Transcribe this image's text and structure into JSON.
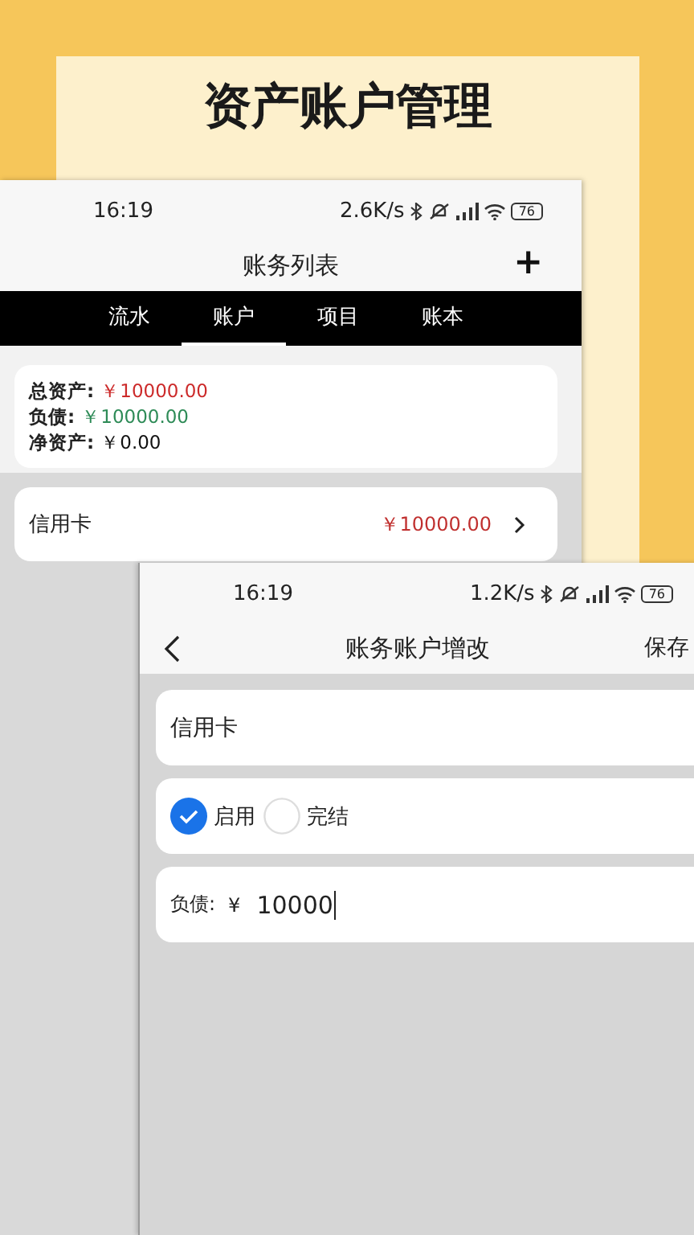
{
  "heading": "资产账户管理",
  "back_screen": {
    "status_bar": {
      "time": "16:19",
      "speed": "2.6K/s",
      "battery": "76"
    },
    "title": "账务列表",
    "add_button": "+",
    "tabs": [
      {
        "label": "流水",
        "selected": false
      },
      {
        "label": "账户",
        "selected": true
      },
      {
        "label": "项目",
        "selected": false
      },
      {
        "label": "账本",
        "selected": false
      }
    ],
    "summary": [
      {
        "label": "总资产:",
        "value": "￥10000.00",
        "color": "#cc2a2a"
      },
      {
        "label": "负债:",
        "value": "￥10000.00",
        "color": "#2e8b57"
      },
      {
        "label": "净资产:",
        "value": "￥0.00",
        "color": "#111111"
      }
    ],
    "accounts": [
      {
        "name": "信用卡",
        "amount": "￥10000.00"
      }
    ]
  },
  "front_screen": {
    "status_bar": {
      "time": "16:19",
      "speed": "1.2K/s",
      "battery": "76"
    },
    "title": "账务账户增改",
    "save_button": "保存",
    "name_value": "信用卡",
    "status_options": [
      {
        "label": "启用",
        "selected": true
      },
      {
        "label": "完结",
        "selected": false
      }
    ],
    "debt_field": {
      "label": "负债:",
      "currency": "¥",
      "value": "10000"
    }
  }
}
